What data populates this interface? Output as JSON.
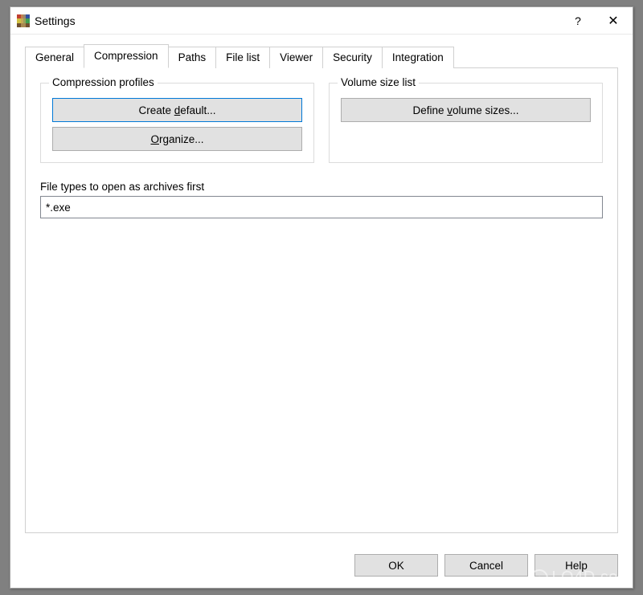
{
  "window": {
    "title": "Settings",
    "help_tooltip": "?",
    "close_tooltip": "✕"
  },
  "tabs": [
    {
      "label": "General"
    },
    {
      "label": "Compression",
      "active": true
    },
    {
      "label": "Paths"
    },
    {
      "label": "File list"
    },
    {
      "label": "Viewer"
    },
    {
      "label": "Security"
    },
    {
      "label": "Integration"
    }
  ],
  "compression_profiles": {
    "legend": "Compression profiles",
    "create_default": "Create default...",
    "organize": "Organize..."
  },
  "volume_size_list": {
    "legend": "Volume size list",
    "define_volume_sizes": "Define volume sizes..."
  },
  "file_types": {
    "label": "File types to open as archives first",
    "value": "*.exe"
  },
  "buttons": {
    "ok": "OK",
    "cancel": "Cancel",
    "help": "Help"
  },
  "watermark": "LO4D.com"
}
